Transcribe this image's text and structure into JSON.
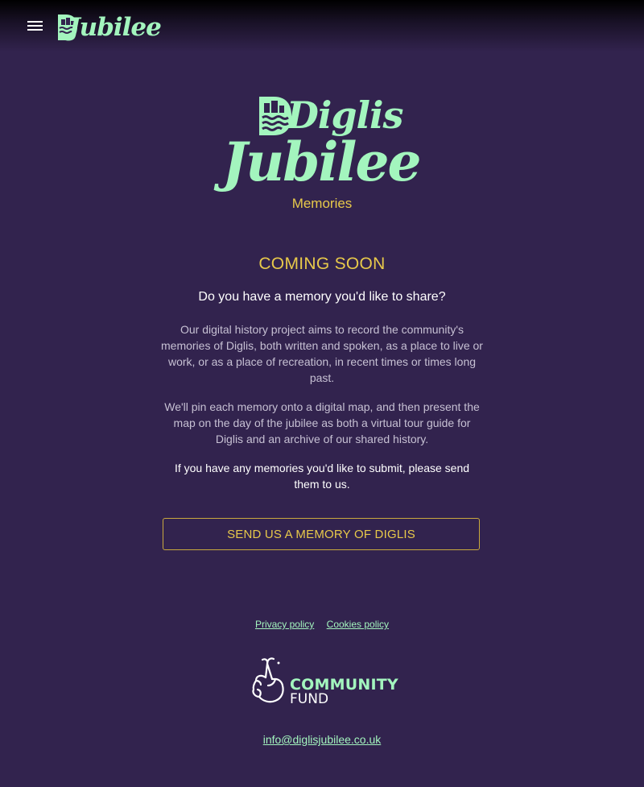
{
  "header": {
    "logo_text": "Jubilee",
    "menu_icon": "hamburger-menu-icon"
  },
  "hero": {
    "logo_line1": "Diglis",
    "logo_line2": "Jubilee",
    "subtitle": "Memories"
  },
  "main": {
    "status": "COMING SOON",
    "question": "Do you have a memory you'd like to share?",
    "paragraph1": "Our digital history project aims to record the community's memories of Diglis, both written and spoken, as a place to live or work, or as a place of recreation, in recent times or times long past.",
    "paragraph2": "We'll pin each memory onto a digital map, and then present the map on the day of the jubilee as both a virtual tour guide for Diglis and an archive of our shared history.",
    "paragraph3": "If you have any memories you'd like to submit, please send them to us.",
    "cta_label": "SEND US A MEMORY OF DIGLIS"
  },
  "footer": {
    "privacy_label": "Privacy policy",
    "cookies_label": "Cookies policy",
    "fund_line1": "COMMUNITY",
    "fund_line2": "FUND",
    "email": "info@diglisjubilee.co.uk"
  },
  "colors": {
    "background": "#32234e",
    "mint": "#a3f5be",
    "gold": "#e8c94a"
  }
}
